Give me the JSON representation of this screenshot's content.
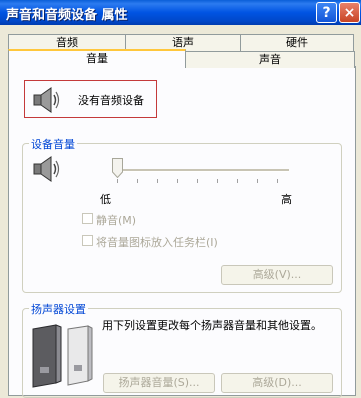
{
  "window": {
    "title": "声音和音频设备 属性",
    "help_glyph": "?",
    "close_glyph": "×"
  },
  "tabs": {
    "row1": [
      "音频",
      "语声",
      "硬件"
    ],
    "row2": [
      "音量",
      "声音"
    ],
    "active": "音量"
  },
  "device": {
    "name": "没有音频设备",
    "icon": "speaker-icon"
  },
  "volume_group": {
    "title": "设备音量",
    "low_label": "低",
    "high_label": "高",
    "level": 0,
    "mute_label": "静音(M)",
    "mute_checked": false,
    "tray_label": "将音量图标放入任务栏(I)",
    "tray_checked": false,
    "advanced_button": "高级(V)..."
  },
  "speaker_group": {
    "title": "扬声器设置",
    "description": "用下列设置更改每个扬声器音量和其他设置。",
    "speaker_volume_button": "扬声器音量(S)...",
    "advanced_button": "高级(D)..."
  }
}
